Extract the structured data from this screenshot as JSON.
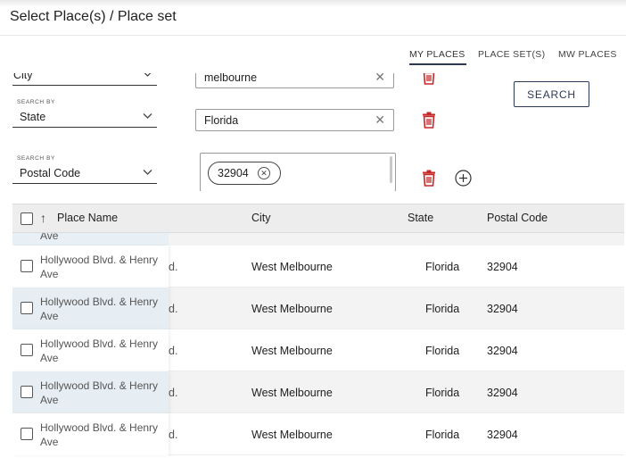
{
  "header": {
    "title": "Select Place(s) / Place set"
  },
  "tabs": [
    {
      "label": "MY PLACES",
      "active": true
    },
    {
      "label": "PLACE SET(S)",
      "active": false
    },
    {
      "label": "MW PLACES",
      "active": false
    }
  ],
  "filters": [
    {
      "search_by_label": "",
      "field": "City",
      "value": "melbourne",
      "value_type": "text"
    },
    {
      "search_by_label": "SEARCH BY",
      "field": "State",
      "value": "Florida",
      "value_type": "text"
    },
    {
      "search_by_label": "SEARCH BY",
      "field": "Postal Code",
      "chips": [
        "32904"
      ],
      "value_type": "chips"
    }
  ],
  "search_button": {
    "label": "SEARCH"
  },
  "icons": {
    "trash": "trash-icon",
    "add": "plus-circle-icon",
    "clear": "close-icon",
    "chevron": "chevron-down-icon",
    "sort": "arrow-up-icon"
  },
  "colors": {
    "trash": "#c62828",
    "accent": "#2b3a55",
    "header_bg": "#ededed",
    "row_alt": "#f3f3f3",
    "frozen_alt": "#e6eef3"
  },
  "table": {
    "columns": [
      "Place Name",
      "City",
      "State",
      "Postal Code"
    ],
    "partial_row_text": "Ave",
    "rows": [
      {
        "place_name": "Hollywood Blvd. & Henry Ave",
        "overflow": "d.",
        "city": "West Melbourne",
        "state": "Florida",
        "postal_code": "32904"
      },
      {
        "place_name": "Hollywood Blvd. & Henry Ave",
        "overflow": "d.",
        "city": "West Melbourne",
        "state": "Florida",
        "postal_code": "32904"
      },
      {
        "place_name": "Hollywood Blvd. & Henry Ave",
        "overflow": "d.",
        "city": "West Melbourne",
        "state": "Florida",
        "postal_code": "32904"
      },
      {
        "place_name": "Hollywood Blvd. & Henry Ave",
        "overflow": "d.",
        "city": "West Melbourne",
        "state": "Florida",
        "postal_code": "32904"
      },
      {
        "place_name": "Hollywood Blvd. & Henry Ave",
        "overflow": "d.",
        "city": "West Melbourne",
        "state": "Florida",
        "postal_code": "32904"
      }
    ]
  }
}
